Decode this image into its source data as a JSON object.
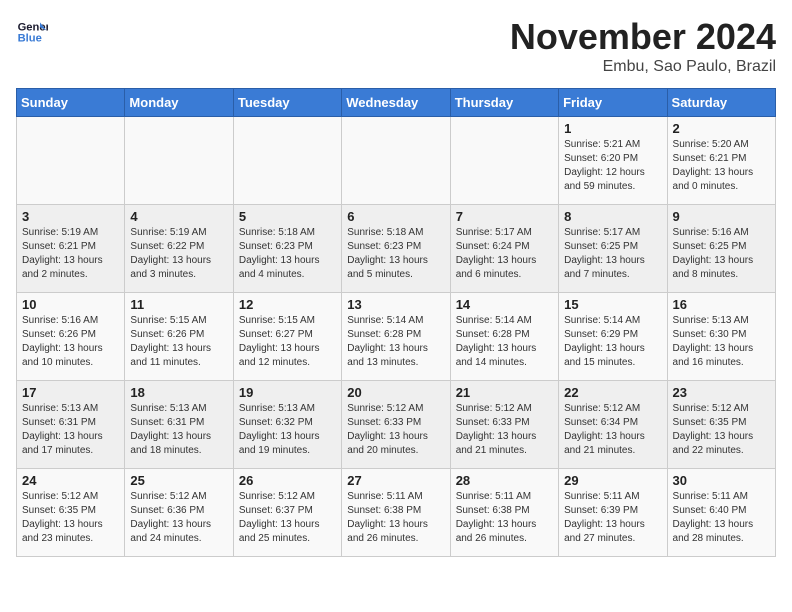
{
  "header": {
    "logo_line1": "General",
    "logo_line2": "Blue",
    "month": "November 2024",
    "location": "Embu, Sao Paulo, Brazil"
  },
  "weekdays": [
    "Sunday",
    "Monday",
    "Tuesday",
    "Wednesday",
    "Thursday",
    "Friday",
    "Saturday"
  ],
  "weeks": [
    [
      {
        "day": "",
        "info": ""
      },
      {
        "day": "",
        "info": ""
      },
      {
        "day": "",
        "info": ""
      },
      {
        "day": "",
        "info": ""
      },
      {
        "day": "",
        "info": ""
      },
      {
        "day": "1",
        "info": "Sunrise: 5:21 AM\nSunset: 6:20 PM\nDaylight: 12 hours\nand 59 minutes."
      },
      {
        "day": "2",
        "info": "Sunrise: 5:20 AM\nSunset: 6:21 PM\nDaylight: 13 hours\nand 0 minutes."
      }
    ],
    [
      {
        "day": "3",
        "info": "Sunrise: 5:19 AM\nSunset: 6:21 PM\nDaylight: 13 hours\nand 2 minutes."
      },
      {
        "day": "4",
        "info": "Sunrise: 5:19 AM\nSunset: 6:22 PM\nDaylight: 13 hours\nand 3 minutes."
      },
      {
        "day": "5",
        "info": "Sunrise: 5:18 AM\nSunset: 6:23 PM\nDaylight: 13 hours\nand 4 minutes."
      },
      {
        "day": "6",
        "info": "Sunrise: 5:18 AM\nSunset: 6:23 PM\nDaylight: 13 hours\nand 5 minutes."
      },
      {
        "day": "7",
        "info": "Sunrise: 5:17 AM\nSunset: 6:24 PM\nDaylight: 13 hours\nand 6 minutes."
      },
      {
        "day": "8",
        "info": "Sunrise: 5:17 AM\nSunset: 6:25 PM\nDaylight: 13 hours\nand 7 minutes."
      },
      {
        "day": "9",
        "info": "Sunrise: 5:16 AM\nSunset: 6:25 PM\nDaylight: 13 hours\nand 8 minutes."
      }
    ],
    [
      {
        "day": "10",
        "info": "Sunrise: 5:16 AM\nSunset: 6:26 PM\nDaylight: 13 hours\nand 10 minutes."
      },
      {
        "day": "11",
        "info": "Sunrise: 5:15 AM\nSunset: 6:26 PM\nDaylight: 13 hours\nand 11 minutes."
      },
      {
        "day": "12",
        "info": "Sunrise: 5:15 AM\nSunset: 6:27 PM\nDaylight: 13 hours\nand 12 minutes."
      },
      {
        "day": "13",
        "info": "Sunrise: 5:14 AM\nSunset: 6:28 PM\nDaylight: 13 hours\nand 13 minutes."
      },
      {
        "day": "14",
        "info": "Sunrise: 5:14 AM\nSunset: 6:28 PM\nDaylight: 13 hours\nand 14 minutes."
      },
      {
        "day": "15",
        "info": "Sunrise: 5:14 AM\nSunset: 6:29 PM\nDaylight: 13 hours\nand 15 minutes."
      },
      {
        "day": "16",
        "info": "Sunrise: 5:13 AM\nSunset: 6:30 PM\nDaylight: 13 hours\nand 16 minutes."
      }
    ],
    [
      {
        "day": "17",
        "info": "Sunrise: 5:13 AM\nSunset: 6:31 PM\nDaylight: 13 hours\nand 17 minutes."
      },
      {
        "day": "18",
        "info": "Sunrise: 5:13 AM\nSunset: 6:31 PM\nDaylight: 13 hours\nand 18 minutes."
      },
      {
        "day": "19",
        "info": "Sunrise: 5:13 AM\nSunset: 6:32 PM\nDaylight: 13 hours\nand 19 minutes."
      },
      {
        "day": "20",
        "info": "Sunrise: 5:12 AM\nSunset: 6:33 PM\nDaylight: 13 hours\nand 20 minutes."
      },
      {
        "day": "21",
        "info": "Sunrise: 5:12 AM\nSunset: 6:33 PM\nDaylight: 13 hours\nand 21 minutes."
      },
      {
        "day": "22",
        "info": "Sunrise: 5:12 AM\nSunset: 6:34 PM\nDaylight: 13 hours\nand 21 minutes."
      },
      {
        "day": "23",
        "info": "Sunrise: 5:12 AM\nSunset: 6:35 PM\nDaylight: 13 hours\nand 22 minutes."
      }
    ],
    [
      {
        "day": "24",
        "info": "Sunrise: 5:12 AM\nSunset: 6:35 PM\nDaylight: 13 hours\nand 23 minutes."
      },
      {
        "day": "25",
        "info": "Sunrise: 5:12 AM\nSunset: 6:36 PM\nDaylight: 13 hours\nand 24 minutes."
      },
      {
        "day": "26",
        "info": "Sunrise: 5:12 AM\nSunset: 6:37 PM\nDaylight: 13 hours\nand 25 minutes."
      },
      {
        "day": "27",
        "info": "Sunrise: 5:11 AM\nSunset: 6:38 PM\nDaylight: 13 hours\nand 26 minutes."
      },
      {
        "day": "28",
        "info": "Sunrise: 5:11 AM\nSunset: 6:38 PM\nDaylight: 13 hours\nand 26 minutes."
      },
      {
        "day": "29",
        "info": "Sunrise: 5:11 AM\nSunset: 6:39 PM\nDaylight: 13 hours\nand 27 minutes."
      },
      {
        "day": "30",
        "info": "Sunrise: 5:11 AM\nSunset: 6:40 PM\nDaylight: 13 hours\nand 28 minutes."
      }
    ]
  ]
}
